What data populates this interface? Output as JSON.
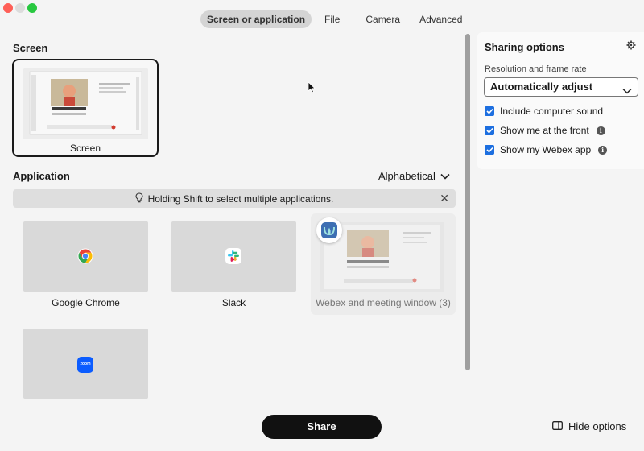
{
  "window": {
    "tabs": [
      {
        "label": "Screen or application",
        "active": true
      },
      {
        "label": "File",
        "active": false
      },
      {
        "label": "Camera",
        "active": false
      },
      {
        "label": "Advanced",
        "active": false
      }
    ]
  },
  "screen_section": {
    "title": "Screen",
    "cards": [
      {
        "label": "Screen",
        "selected": true
      }
    ]
  },
  "application_section": {
    "title": "Application",
    "sort_label": "Alphabetical",
    "banner_text": "Holding Shift to select multiple applications.",
    "apps": [
      {
        "label": "Google Chrome",
        "icon": "chrome-icon"
      },
      {
        "label": "Slack",
        "icon": "slack-icon"
      },
      {
        "label": "Webex and meeting window (3)",
        "icon": "webex-icon",
        "disabled": true
      },
      {
        "label": "",
        "icon": "zoom-icon",
        "icon_text": "zoom"
      }
    ]
  },
  "sidebar": {
    "title": "Sharing options",
    "resolution_label": "Resolution and frame rate",
    "resolution_value": "Automatically adjust",
    "options": [
      {
        "label": "Include computer sound",
        "checked": true,
        "info": false
      },
      {
        "label": "Show me at the front",
        "checked": true,
        "info": true
      },
      {
        "label": "Show my Webex app",
        "checked": true,
        "info": true
      }
    ]
  },
  "footer": {
    "share_label": "Share",
    "hide_options_label": "Hide options"
  },
  "colors": {
    "accent": "#1d6fe0",
    "primary_button": "#111111",
    "close_dot": "#fe5f57",
    "zoom_dot": "#28c840"
  }
}
